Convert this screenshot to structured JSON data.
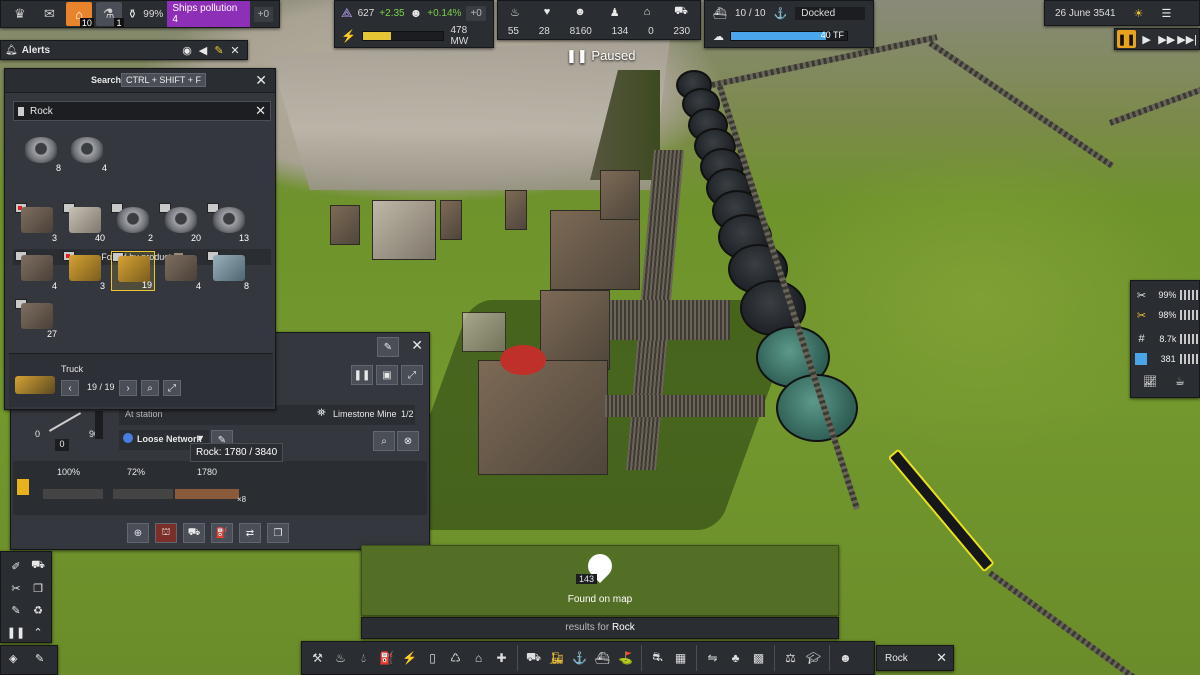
{
  "top_left": {
    "settlement_count": "10",
    "research_count": "1",
    "health": "99%",
    "ships_pollution": "Ships pollution 4",
    "health_delta": "+0"
  },
  "stats_left": {
    "unity": "627",
    "unity_delta": "+2.35",
    "pop_growth": "+0.14%",
    "pop_delta": "+0",
    "power": "478 MW",
    "power_fill": 0.35
  },
  "stats_mid": {
    "food": "55",
    "health": "28",
    "population": "8160",
    "unemployed": "134",
    "homeless": "0",
    "vehicles": "230"
  },
  "stats_right": {
    "ships": "10 / 10",
    "ship_status": "Docked",
    "compute": "40 TF",
    "compute_fill": 0.82
  },
  "status": {
    "paused": "Paused"
  },
  "date": "26 June 3541",
  "alerts": {
    "title": "Alerts"
  },
  "search": {
    "title": "Search",
    "shortcut": "CTRL + SHIFT + F",
    "query": "Rock",
    "direct_results": [
      {
        "icon": "mine-icon",
        "count": "8"
      },
      {
        "icon": "mine-icon",
        "count": "4"
      }
    ],
    "found_by_product": "Found by product",
    "product_results": [
      {
        "icon": "crusher-icon",
        "count": "3"
      },
      {
        "icon": "building-icon",
        "count": "40"
      },
      {
        "icon": "mine-icon",
        "count": "2"
      },
      {
        "icon": "mine-icon",
        "count": "20"
      },
      {
        "icon": "mine-icon",
        "count": "13"
      },
      {
        "icon": "excavator-icon",
        "count": "4"
      },
      {
        "icon": "truck-icon",
        "count": "3"
      },
      {
        "icon": "truck-icon",
        "count": "19"
      },
      {
        "icon": "conveyor-icon",
        "count": "4"
      },
      {
        "icon": "conveyor-icon",
        "count": "8"
      },
      {
        "icon": "conveyor-icon",
        "count": "27"
      }
    ],
    "selected": {
      "label": "Truck",
      "pager": "19 / 19"
    }
  },
  "vehicle": {
    "at_station": "At station",
    "destination": "Limestone Mine",
    "dest_count": "1/2",
    "network": "Loose Network",
    "gauge_low": "0",
    "gauge_high": "90",
    "gauge_value": "0",
    "wagons": [
      {
        "fuel": "100%"
      },
      {
        "fuel": "72%"
      },
      {
        "fuel": "1780",
        "multiplier": "×8"
      }
    ]
  },
  "tooltip": "Rock: 1780 / 3840",
  "found_on_map": {
    "count": "143",
    "label": "Found on map"
  },
  "results_for": {
    "prefix": "results for",
    "query": "Rock"
  },
  "bottom_search": {
    "value": "Rock"
  },
  "right_panel": [
    {
      "icon": "tools-icon",
      "value": "99%"
    },
    {
      "icon": "maintenance-icon",
      "value": "98%"
    },
    {
      "icon": "rail-icon",
      "value": "8.7k"
    },
    {
      "icon": "square-icon",
      "value": "381"
    }
  ],
  "colors": {
    "accent": "#e8842c",
    "pollution": "#8e2fb8",
    "power_bar": "#e5c533",
    "compute_bar": "#4aa6e8",
    "selection": "#e8e020"
  }
}
